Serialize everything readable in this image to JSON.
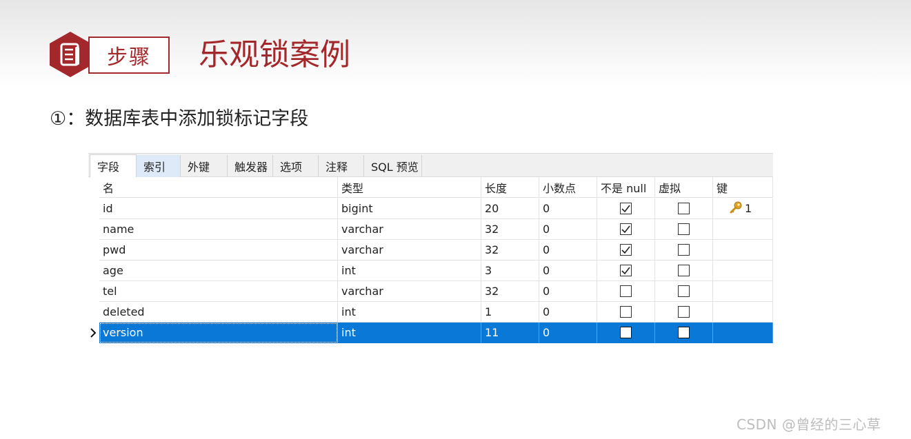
{
  "slide": {
    "step_label": "步骤",
    "title": "乐观锁案例",
    "step_text": "①：数据库表中添加锁标记字段",
    "accent_color": "#a3282b",
    "badge_icon": "document-icon"
  },
  "designer": {
    "tabs": [
      {
        "label": "字段",
        "state": "active"
      },
      {
        "label": "索引",
        "state": "hover"
      },
      {
        "label": "外键",
        "state": "normal"
      },
      {
        "label": "触发器",
        "state": "normal"
      },
      {
        "label": "选项",
        "state": "normal"
      },
      {
        "label": "注释",
        "state": "normal"
      },
      {
        "label": "SQL 预览",
        "state": "normal"
      }
    ],
    "columns": [
      "名",
      "类型",
      "长度",
      "小数点",
      "不是 null",
      "虚拟",
      "键"
    ],
    "rows": [
      {
        "name": "id",
        "type": "bigint",
        "length": "20",
        "decimals": "0",
        "not_null": true,
        "virtual": false,
        "key": "1"
      },
      {
        "name": "name",
        "type": "varchar",
        "length": "32",
        "decimals": "0",
        "not_null": true,
        "virtual": false,
        "key": ""
      },
      {
        "name": "pwd",
        "type": "varchar",
        "length": "32",
        "decimals": "0",
        "not_null": true,
        "virtual": false,
        "key": ""
      },
      {
        "name": "age",
        "type": "int",
        "length": "3",
        "decimals": "0",
        "not_null": true,
        "virtual": false,
        "key": ""
      },
      {
        "name": "tel",
        "type": "varchar",
        "length": "32",
        "decimals": "0",
        "not_null": false,
        "virtual": false,
        "key": ""
      },
      {
        "name": "deleted",
        "type": "int",
        "length": "1",
        "decimals": "0",
        "not_null": false,
        "virtual": false,
        "key": ""
      },
      {
        "name": "version",
        "type": "int",
        "length": "11",
        "decimals": "0",
        "not_null": false,
        "virtual": false,
        "key": "",
        "selected": true
      }
    ],
    "selection_color": "#0a78d7",
    "key_icon": "key-icon",
    "row_marker_icon": "row-pointer-icon"
  },
  "watermark": "CSDN @曾经的三心草"
}
